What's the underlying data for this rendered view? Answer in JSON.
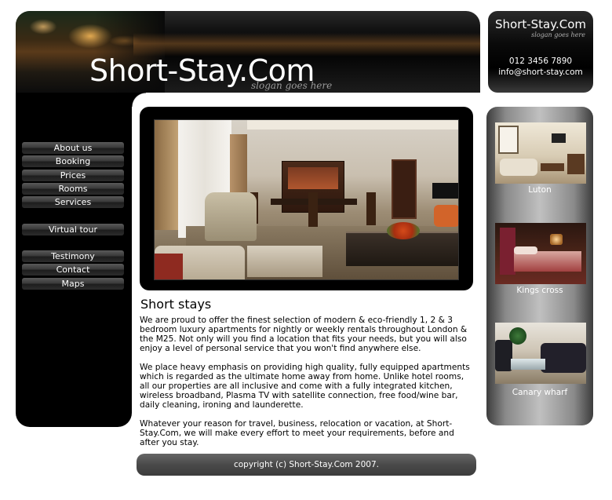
{
  "header": {
    "site_title": "Short-Stay.Com",
    "slogan": "slogan goes here"
  },
  "contact": {
    "title": "Short-Stay.Com",
    "slogan": "slogan goes here",
    "phone": "012 3456 7890",
    "email": "info@short-stay.com"
  },
  "nav": {
    "items": [
      {
        "label": "About us"
      },
      {
        "label": "Booking"
      },
      {
        "label": "Prices"
      },
      {
        "label": "Rooms"
      },
      {
        "label": "Services"
      },
      {
        "label": "Virtual tour"
      },
      {
        "label": "Testimony"
      },
      {
        "label": "Contact"
      },
      {
        "label": "Maps"
      }
    ]
  },
  "content": {
    "heading": "Short stays",
    "paragraphs": [
      "We are proud to offer the finest selection of modern & eco-friendly 1, 2 & 3 bedroom luxury apartments for nightly or weekly rentals throughout London & the M25. Not only will you find a location that fits your needs, but you will also enjoy a level of personal service that you won't find anywhere else.",
      "We place heavy emphasis on providing high quality, fully equipped apartments which is regarded as the ultimate home away from home. Unlike hotel rooms, all our properties are all inclusive and come with a fully integrated kitchen, wireless broadband, Plasma TV with satellite connection, free food/wine bar, daily cleaning, ironing and launderette.",
      "Whatever your reason for travel, business, relocation or vacation, at Short-Stay.Com, we will make every effort to meet your requirements, before and after you stay."
    ]
  },
  "locations": [
    {
      "name": "Luton"
    },
    {
      "name": "Kings cross"
    },
    {
      "name": "Canary wharf"
    }
  ],
  "footer": {
    "copyright": "copyright (c) Short-Stay.Com 2007."
  }
}
